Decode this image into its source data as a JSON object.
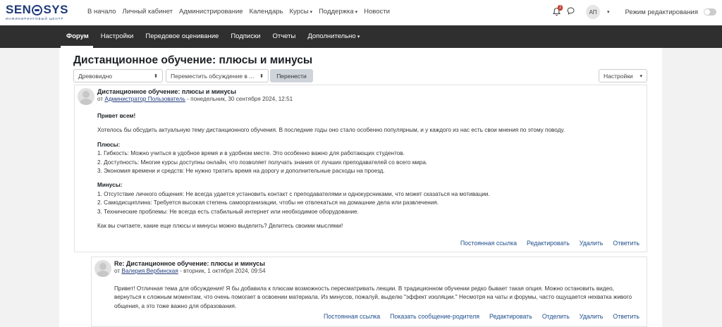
{
  "logo": {
    "left": "SEN",
    "right": "SYS",
    "subtitle": "ИНЖИНИРИНГОВЫЙ ЦЕНТР"
  },
  "topnav": [
    "В начало",
    "Личный кабинет",
    "Администрирование",
    "Календарь",
    "Курсы",
    "Поддержка",
    "Новости"
  ],
  "topnav_dropdowns": [
    "Курсы",
    "Поддержка"
  ],
  "user": {
    "notification_count": "2",
    "initials": "АП",
    "edit_mode_label": "Режим редактирования"
  },
  "secnav": [
    "Форум",
    "Настройки",
    "Передовое оценивание",
    "Подписки",
    "Отчеты",
    "Дополнительно"
  ],
  "page_title": "Дистанционное обучение: плюсы и минусы",
  "controls": {
    "display_mode": "Древовидно",
    "move_placeholder": "Переместить обсуждение в ...",
    "move_button": "Перенести",
    "settings": "Настройки"
  },
  "post1": {
    "subject": "Дистанционное обучение: плюсы и минусы",
    "by": "от ",
    "author": "Администратор Пользователь",
    "date": " - понедельник, 30 сентября 2024, 12:51",
    "greeting": "Привет всем!",
    "intro": "Хотелось бы обсудить актуальную тему дистанционного обучения. В последние годы оно стало особенно популярным, и у каждого из нас есть свои мнения по этому поводу.",
    "pros_title": "Плюсы:",
    "pros": [
      "1. Гибкость: Можно учиться в удобное время и в удобном месте. Это особенно важно для работающих студентов.",
      "2. Доступность: Многие курсы доступны онлайн, что позволяет получать знания от лучших преподавателей со всего мира.",
      "3. Экономия времени и средств: Не нужно тратить время на дорогу и дополнительные расходы на проезд."
    ],
    "cons_title": "Минусы:",
    "cons": [
      "1. Отсутствие личного общения: Не всегда удается установить контакт с преподавателями и однокурсниками, что может сказаться на мотивации.",
      "2. Самодисциплина: Требуется высокая степень самоорганизации, чтобы не отвлекаться на домашние дела или развлечения.",
      "3. Технические проблемы: Не всегда есть стабильный интернет или необходимое оборудование."
    ],
    "closing": "Как вы считаете, какие еще плюсы и минусы можно выделить? Делитесь своими мыслями!",
    "actions": [
      "Постоянная ссылка",
      "Редактировать",
      "Удалить",
      "Ответить"
    ]
  },
  "post2": {
    "subject": "Re: Дистанционное обучение: плюсы и минусы",
    "by": "от ",
    "author": "Валерия Вербинская",
    "date": " - вторник, 1 октября 2024, 09:54",
    "text": "Привет! Отличная тема для обсуждения! Я бы добавила к плюсам возможность пересматривать лекции. В традиционном обучении редко бывает такая опция. Можно остановить видео, вернуться к сложным моментам, что очень помогает в освоении материала. Из минусов, пожалуй, выделю \"эффект изоляции.\" Несмотря на чаты и форумы, часто ощущается нехватка живого общения, а это тоже важно для образования.",
    "actions": [
      "Постоянная ссылка",
      "Показать сообщение-родителя",
      "Редактировать",
      "Отделить",
      "Удалить",
      "Ответить"
    ]
  }
}
